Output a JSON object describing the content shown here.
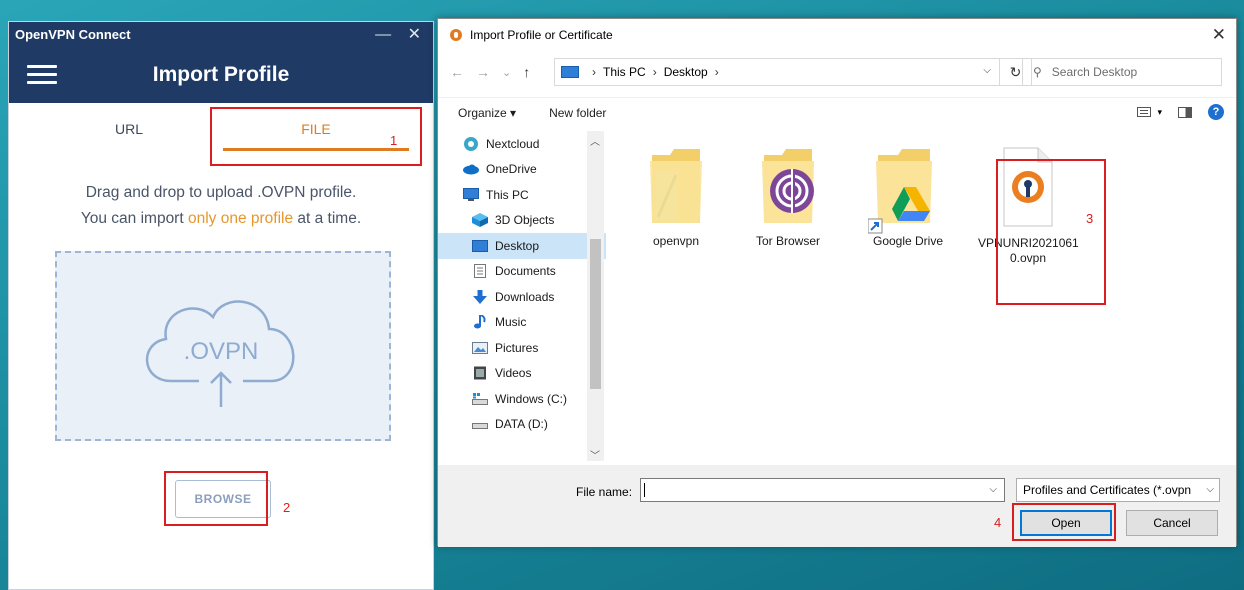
{
  "openvpn": {
    "window_title": "OpenVPN Connect",
    "window_controls": "— ✕",
    "header_title": "Import Profile",
    "tabs": [
      {
        "label": "URL"
      },
      {
        "label": "FILE"
      }
    ],
    "desc_line1": "Drag and drop to upload .OVPN profile.",
    "desc_line2_pre": "You can import ",
    "desc_line2_hl": "only one profile",
    "desc_line2_post": " at a time.",
    "dropzone_text": ".OVPN",
    "browse_label": "BROWSE"
  },
  "annotations": [
    "1",
    "2",
    "3",
    "4"
  ],
  "dialog": {
    "title": "Import Profile or Certificate",
    "close": "✕",
    "nav": {
      "back": "←",
      "forward": "→",
      "recent": "⌄",
      "up": "↑"
    },
    "address": {
      "segments": [
        "This PC",
        "Desktop"
      ],
      "sep": "›"
    },
    "refresh": "↻",
    "search_placeholder": "Search Desktop",
    "commands": {
      "organize": "Organize ▾",
      "new_folder": "New folder",
      "view_dd": "▾",
      "help": "?"
    },
    "sidebar": [
      {
        "label": "Nextcloud",
        "icon": "nextcloud-icon"
      },
      {
        "label": "OneDrive",
        "icon": "onedrive-icon"
      },
      {
        "label": "This PC",
        "icon": "this-pc-icon"
      },
      {
        "label": "3D Objects",
        "icon": "3d-objects-icon"
      },
      {
        "label": "Desktop",
        "icon": "desktop-icon",
        "selected": true
      },
      {
        "label": "Documents",
        "icon": "documents-icon"
      },
      {
        "label": "Downloads",
        "icon": "downloads-icon"
      },
      {
        "label": "Music",
        "icon": "music-icon"
      },
      {
        "label": "Pictures",
        "icon": "pictures-icon"
      },
      {
        "label": "Videos",
        "icon": "videos-icon"
      },
      {
        "label": "Windows (C:)",
        "icon": "drive-c-icon"
      },
      {
        "label": "DATA (D:)",
        "icon": "drive-d-icon"
      }
    ],
    "files": [
      {
        "name": "openvpn",
        "icon": "folder-icon"
      },
      {
        "name": "Tor Browser",
        "icon": "tor-folder-icon"
      },
      {
        "name": "Google Drive",
        "icon": "google-drive-folder-icon"
      },
      {
        "name_line1": "VPNUNRI2021061",
        "name_line2": "0.ovpn",
        "icon": "ovpn-file-icon"
      }
    ],
    "file_name_label": "File name:",
    "file_name_value": "",
    "file_type": "Profiles and Certificates (*.ovpn",
    "open_label": "Open",
    "cancel_label": "Cancel"
  },
  "colors": {
    "accent": "#e17b22",
    "header": "#1f3a64",
    "annotation": "#d81e1e",
    "selection": "#cce4f7"
  }
}
